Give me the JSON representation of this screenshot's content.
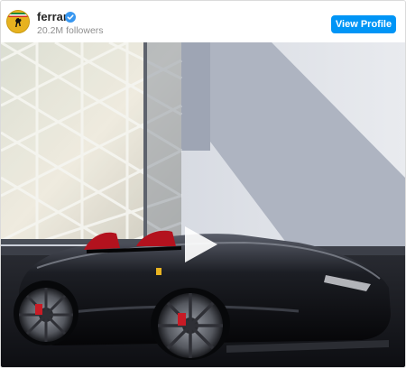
{
  "post": {
    "account": {
      "username": "ferrari",
      "verified": true,
      "followers_text": "20.2M followers",
      "avatar_icon": "ferrari-prancing-horse-logo-icon",
      "avatar_color": "#e7b21f"
    },
    "actions": {
      "view_profile_label": "View Profile",
      "button_color": "#0095f6"
    },
    "media": {
      "type": "video",
      "play_icon": "play-icon"
    }
  }
}
